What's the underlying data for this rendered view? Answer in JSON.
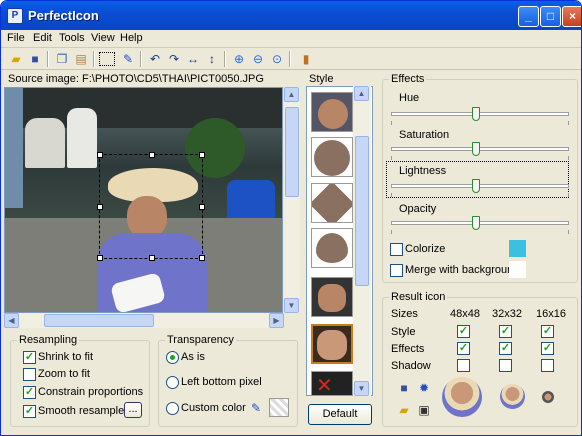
{
  "window": {
    "title": "PerfectIcon",
    "app_icon": "perfecticon-icon"
  },
  "titlebar_buttons": {
    "minimize": "_",
    "maximize": "□",
    "close": "×"
  },
  "menu": [
    "File",
    "Edit",
    "Tools",
    "View",
    "Help"
  ],
  "toolbar_icons": [
    "open-folder-icon",
    "save-icon",
    "copy-icon",
    "paste-icon",
    "select-rectangle-icon",
    "pen-icon",
    "rotate-left-icon",
    "rotate-right-icon",
    "flip-horizontal-icon",
    "flip-vertical-icon",
    "zoom-in-icon",
    "zoom-out-icon",
    "zoom-fit-icon",
    "book-icon"
  ],
  "source_label": "Source image: F:\\PHOTO\\CD5\\THAI\\PICT0050.JPG",
  "resampling": {
    "title": "Resampling",
    "options": [
      {
        "label": "Shrink to fit",
        "checked": true
      },
      {
        "label": "Zoom to fit",
        "checked": false
      },
      {
        "label": "Constrain proportions",
        "checked": true
      },
      {
        "label": "Smooth resample",
        "checked": true
      }
    ],
    "more_button": "..."
  },
  "transparency": {
    "title": "Transparency",
    "options": [
      {
        "label": "As is",
        "selected": true
      },
      {
        "label": "Left bottom pixel",
        "selected": false
      },
      {
        "label": "Custom color",
        "selected": false
      }
    ]
  },
  "style": {
    "title": "Style",
    "default_button": "Default"
  },
  "effects": {
    "title": "Effects",
    "sliders": [
      {
        "label": "Hue",
        "value": 0.5
      },
      {
        "label": "Saturation",
        "value": 0.5
      },
      {
        "label": "Lightness",
        "value": 0.5
      },
      {
        "label": "Opacity",
        "value": 0.5
      }
    ],
    "colorize": {
      "label": "Colorize",
      "checked": false,
      "color": "#3cbfe0"
    },
    "merge": {
      "label": "Merge with background",
      "checked": false,
      "color": "#ffffff"
    }
  },
  "result": {
    "title": "Result icon",
    "sizes_label": "Sizes",
    "sizes": [
      "48x48",
      "32x32",
      "16x16"
    ],
    "rows": [
      {
        "label": "Style",
        "values": [
          true,
          true,
          true
        ]
      },
      {
        "label": "Effects",
        "values": [
          true,
          true,
          true
        ]
      },
      {
        "label": "Shadow",
        "values": [
          false,
          false,
          false
        ]
      }
    ]
  }
}
